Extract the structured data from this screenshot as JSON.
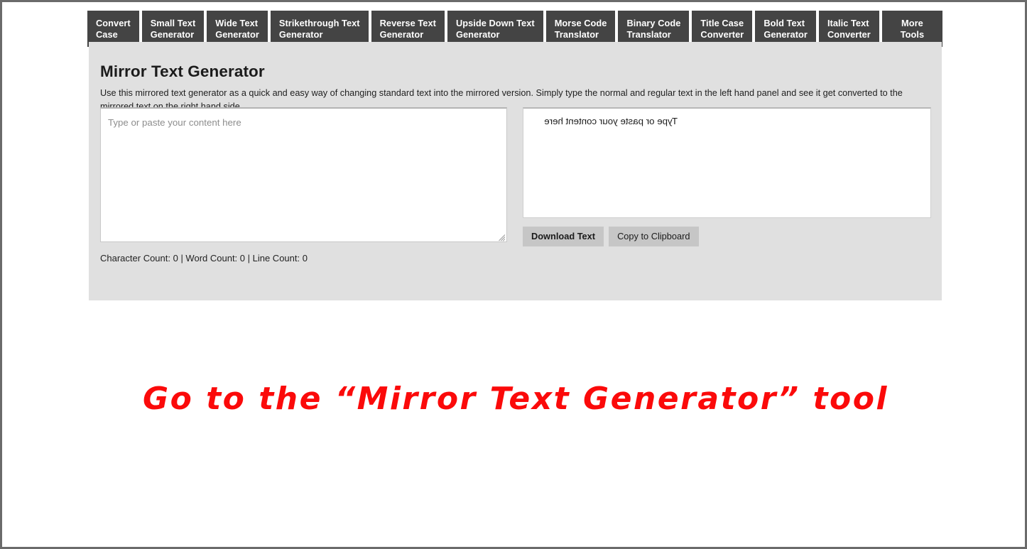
{
  "nav": {
    "tabs": [
      {
        "line1": "Convert",
        "line2": "Case",
        "align": "left"
      },
      {
        "line1": "Small Text",
        "line2": "Generator",
        "align": "left"
      },
      {
        "line1": "Wide Text",
        "line2": "Generator",
        "align": "left"
      },
      {
        "line1": "Strikethrough Text",
        "line2": "Generator",
        "align": "left"
      },
      {
        "line1": "Reverse Text",
        "line2": "Generator",
        "align": "left"
      },
      {
        "line1": "Upside Down Text",
        "line2": "Generator",
        "align": "left"
      },
      {
        "line1": "Morse Code",
        "line2": "Translator",
        "align": "left"
      },
      {
        "line1": "Binary Code",
        "line2": "Translator",
        "align": "left"
      },
      {
        "line1": "Title Case",
        "line2": "Converter",
        "align": "left"
      },
      {
        "line1": "Bold Text",
        "line2": "Generator",
        "align": "left"
      },
      {
        "line1": "Italic Text",
        "line2": "Converter",
        "align": "left"
      },
      {
        "line1": "More",
        "line2": "Tools",
        "align": "center"
      }
    ]
  },
  "page": {
    "title": "Mirror Text Generator",
    "description": "Use this mirrored text generator as a quick and easy way of changing standard text into the mirrored version. Simply type the normal and regular text in the left hand panel and see it get converted to the mirrored text on the right hand side."
  },
  "editor": {
    "input_placeholder": "Type or paste your content here",
    "input_value": "",
    "output_text": "Type or paste your content here",
    "download_label": "Download Text",
    "copy_label": "Copy to Clipboard",
    "counts_text": "Character Count: 0 | Word Count: 0 | Line Count: 0",
    "character_count": 0,
    "word_count": 0,
    "line_count": 0
  },
  "annotation": {
    "text": "Go to the “Mirror Text Generator” tool",
    "color": "#fb0a0a"
  },
  "colors": {
    "tab_background": "#444444",
    "panel_background": "#e0e0e0",
    "button_background": "#c6c6c6",
    "page_border": "#6b6b6b"
  }
}
